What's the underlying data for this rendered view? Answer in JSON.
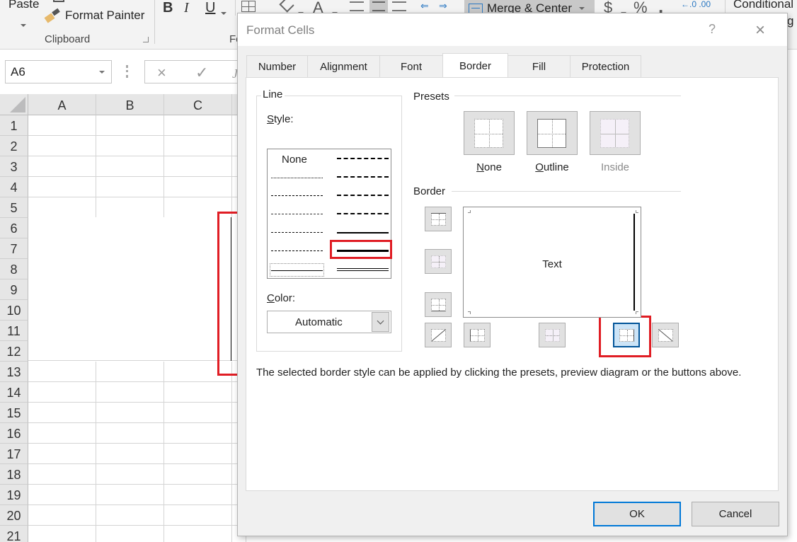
{
  "ribbon": {
    "paste_label": "Paste",
    "format_painter_label": "Format Painter",
    "clipboard_group_label": "Clipboard",
    "font_group_label_partial": "Fo",
    "bold_label": "B",
    "italic_label": "I",
    "underline_label": "U",
    "merge_center_label": "Merge & Center",
    "currency_label": "$",
    "percent_label": "%",
    "comma_label": ",",
    "increase_decimal_label": "←.0 .00",
    "conditional_label": "Conditional",
    "conditional_sub_partial": "g"
  },
  "formula_bar": {
    "name_box_value": "A6",
    "cancel_icon": "×",
    "enter_icon": "✓",
    "fx_partial": "J"
  },
  "grid": {
    "columns": [
      "A",
      "B",
      "C"
    ],
    "rows": [
      "1",
      "2",
      "3",
      "4",
      "5",
      "6",
      "7",
      "8",
      "9",
      "10",
      "11",
      "12",
      "13",
      "14",
      "15",
      "16",
      "17",
      "18",
      "19",
      "20",
      "21"
    ],
    "selected_range": "A6:C12",
    "applied_border": "right"
  },
  "dialog": {
    "title": "Format Cells",
    "help_label": "?",
    "close_label": "×",
    "tabs": [
      {
        "label": "Number",
        "active": false
      },
      {
        "label": "Alignment",
        "active": false
      },
      {
        "label": "Font",
        "active": false
      },
      {
        "label": "Border",
        "active": true
      },
      {
        "label": "Fill",
        "active": false
      },
      {
        "label": "Protection",
        "active": false
      }
    ],
    "line": {
      "group_label": "Line",
      "style_label_prefix": "S",
      "style_label_rest": "tyle:",
      "none_option": "None",
      "selected_style": "thick-solid",
      "color_label_prefix": "C",
      "color_label_rest": "olor:",
      "color_value": "Automatic"
    },
    "presets": {
      "group_label": "Presets",
      "items": [
        {
          "prefix": "N",
          "rest": "one",
          "enabled": true
        },
        {
          "prefix": "O",
          "rest": "utline",
          "enabled": true
        },
        {
          "prefix": "",
          "rest": "Inside",
          "enabled": false
        }
      ]
    },
    "border": {
      "group_label": "Border",
      "preview_text": "Text",
      "active_button": "right-border"
    },
    "info_text": "The selected border style can be applied by clicking the presets, preview diagram or the buttons above.",
    "ok_label": "OK",
    "cancel_label": "Cancel"
  },
  "colors": {
    "highlight_red": "#e01d24",
    "active_button_bg": "#cce4f7",
    "active_button_border": "#005499",
    "default_button_border": "#0078d7"
  }
}
